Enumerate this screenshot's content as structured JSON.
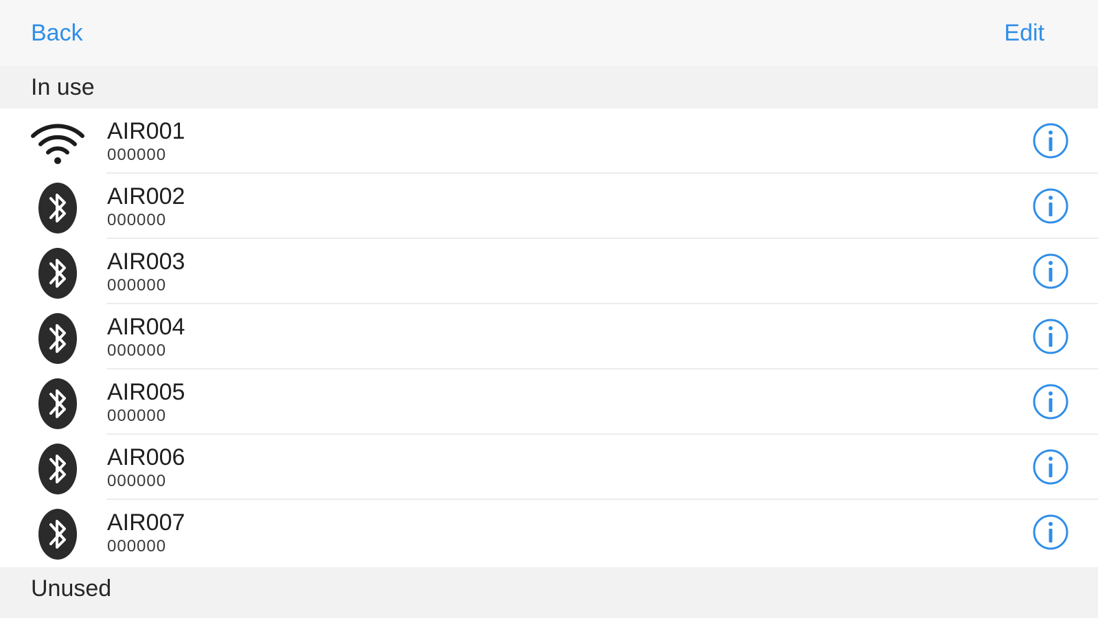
{
  "navbar": {
    "back_label": "Back",
    "edit_label": "Edit"
  },
  "sections": {
    "in_use_title": "In use",
    "unused_title": "Unused"
  },
  "devices": [
    {
      "name": "AIR001",
      "code": "000000",
      "icon": "wifi-icon"
    },
    {
      "name": "AIR002",
      "code": "000000",
      "icon": "bluetooth-icon"
    },
    {
      "name": "AIR003",
      "code": "000000",
      "icon": "bluetooth-icon"
    },
    {
      "name": "AIR004",
      "code": "000000",
      "icon": "bluetooth-icon"
    },
    {
      "name": "AIR005",
      "code": "000000",
      "icon": "bluetooth-icon"
    },
    {
      "name": "AIR006",
      "code": "000000",
      "icon": "bluetooth-icon"
    },
    {
      "name": "AIR007",
      "code": "000000",
      "icon": "bluetooth-icon"
    }
  ],
  "colors": {
    "accent": "#2f8ee8",
    "background": "#f7f7f7",
    "list_background": "#ffffff",
    "icon_dark": "#2b2b2b"
  }
}
